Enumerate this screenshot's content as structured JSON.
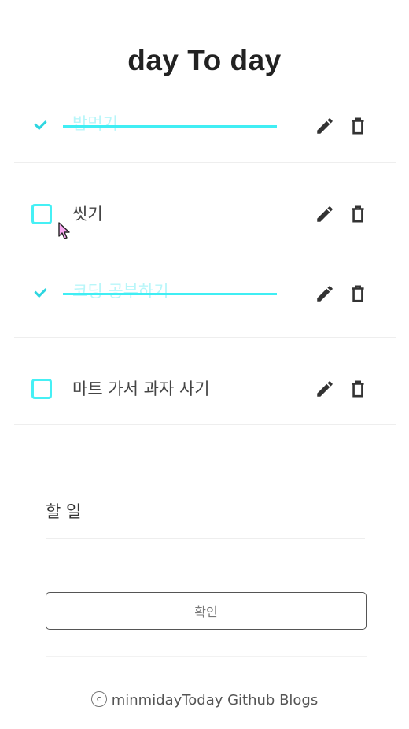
{
  "app": {
    "title": "day To day"
  },
  "todos": [
    {
      "text": "밥먹기",
      "done": true
    },
    {
      "text": "씻기",
      "done": false
    },
    {
      "text": "코딩 공부하기",
      "done": true
    },
    {
      "text": "마트 가서 과자 사기",
      "done": false
    }
  ],
  "form": {
    "placeholder": "할 일",
    "value": "",
    "submit_label": "확인"
  },
  "footer": {
    "copyright_symbol": "c",
    "text": "minmidayToday Github Blogs"
  },
  "colors": {
    "accent": "#46f0f5",
    "done_text": "#b8f6f9",
    "icon": "#333333"
  }
}
